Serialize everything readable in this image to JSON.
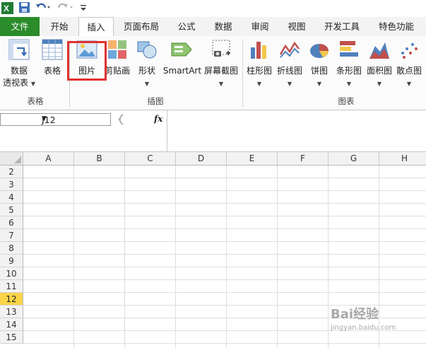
{
  "tabs": [
    "文件",
    "开始",
    "插入",
    "页面布局",
    "公式",
    "数据",
    "审阅",
    "视图",
    "开发工具",
    "特色功能"
  ],
  "ribbon": {
    "pivot_label1": "数据",
    "pivot_label2": "透视表",
    "table_label": "表格",
    "picture_label": "图片",
    "clipart_label": "剪贴画",
    "shapes_label": "形状",
    "smartart_label": "SmartArt",
    "screenshot_label": "屏幕截图",
    "column_label": "柱形图",
    "line_label": "折线图",
    "pie_label": "饼图",
    "bar_label": "条形图",
    "area_label": "面积图",
    "scatter_label": "散点图",
    "group_tables": "表格",
    "group_illustrations": "插图",
    "group_charts": "图表"
  },
  "formula_bar": {
    "name_box": "J12",
    "fx": "fx",
    "formula": ""
  },
  "columns": [
    "A",
    "B",
    "C",
    "D",
    "E",
    "F",
    "G",
    "H"
  ],
  "rows": [
    "2",
    "3",
    "4",
    "5",
    "6",
    "7",
    "8",
    "9",
    "10",
    "11",
    "12",
    "13",
    "14",
    "15"
  ],
  "selected_row": "12",
  "watermark": {
    "brand": "Bai经验",
    "url": "jingyan.baidu.com"
  },
  "colors": {
    "file_tab": "#2a8c2a",
    "highlight": "#e0312f",
    "selected_row": "#fbd44a"
  }
}
